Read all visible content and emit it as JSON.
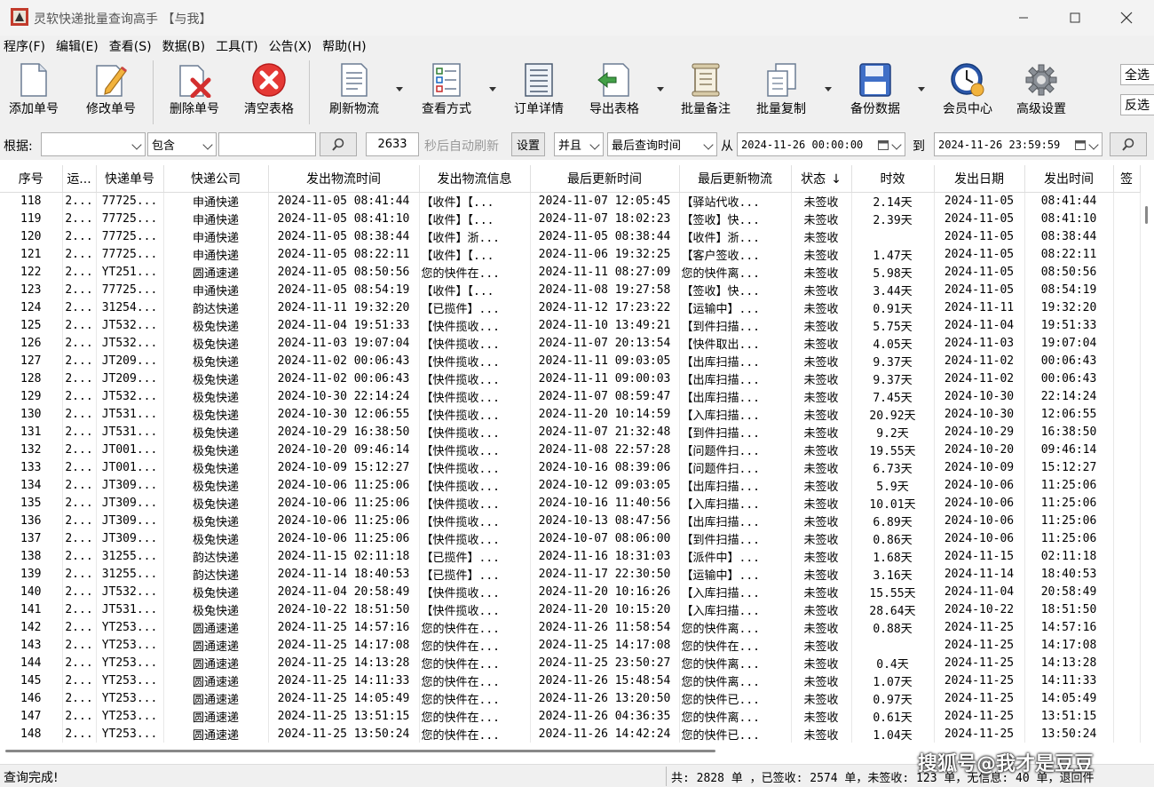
{
  "window": {
    "title": "灵软快递批量查询高手 【与我】"
  },
  "menu": [
    "程序(F)",
    "编辑(E)",
    "查看(S)",
    "数据(B)",
    "工具(T)",
    "公告(X)",
    "帮助(H)"
  ],
  "toolbar": {
    "add": "添加单号",
    "edit": "修改单号",
    "delete": "删除单号",
    "clear": "清空表格",
    "refresh": "刷新物流",
    "view_mode": "查看方式",
    "order_detail": "订单详情",
    "export": "导出表格",
    "batch_note": "批量备注",
    "batch_copy": "批量复制",
    "backup": "备份数据",
    "member": "会员中心",
    "advanced": "高级设置",
    "select_all": "全选",
    "invert": "反选"
  },
  "filter": {
    "basis_label": "根据:",
    "basis_value": "",
    "match": "包含",
    "keyword": "",
    "interval": "2633",
    "auto_refresh": "秒后自动刷新",
    "settings": "设置",
    "logic": "并且",
    "time_field": "最后查询时间",
    "from_label": "从",
    "from": "2024-11-26 00:00:00",
    "to_label": "到",
    "to": "2024-11-26 23:59:59"
  },
  "table": {
    "columns": [
      "序号",
      "运...",
      "快递单号",
      "快递公司",
      "发出物流时间",
      "发出物流信息",
      "最后更新时间",
      "最后更新物流",
      "状态",
      "时效",
      "发出日期",
      "发出时间",
      "签"
    ],
    "sort_col_arrow": "↓",
    "rows": [
      [
        "118",
        "2...",
        "77725...",
        "申通快递",
        "2024-11-05 08:41:44",
        "【收件】【...",
        "2024-11-07 12:05:45",
        "【驿站代收...",
        "未签收",
        "2.14天",
        "2024-11-05",
        "08:41:44"
      ],
      [
        "119",
        "2...",
        "77725...",
        "申通快递",
        "2024-11-05 08:41:10",
        "【收件】【...",
        "2024-11-07 18:02:23",
        "【签收】快...",
        "未签收",
        "2.39天",
        "2024-11-05",
        "08:41:10"
      ],
      [
        "120",
        "2...",
        "77725...",
        "申通快递",
        "2024-11-05 08:38:44",
        "【收件】浙...",
        "2024-11-05 08:38:44",
        "【收件】浙...",
        "未签收",
        "",
        "2024-11-05",
        "08:38:44"
      ],
      [
        "121",
        "2...",
        "77725...",
        "申通快递",
        "2024-11-05 08:22:11",
        "【收件】【...",
        "2024-11-06 19:32:25",
        "【客户签收...",
        "未签收",
        "1.47天",
        "2024-11-05",
        "08:22:11"
      ],
      [
        "122",
        "2...",
        "YT251...",
        "圆通速递",
        "2024-11-05 08:50:56",
        "您的快件在...",
        "2024-11-11 08:27:09",
        "您的快件离...",
        "未签收",
        "5.98天",
        "2024-11-05",
        "08:50:56"
      ],
      [
        "123",
        "2...",
        "77725...",
        "申通快递",
        "2024-11-05 08:54:19",
        "【收件】【...",
        "2024-11-08 19:27:58",
        "【签收】快...",
        "未签收",
        "3.44天",
        "2024-11-05",
        "08:54:19"
      ],
      [
        "124",
        "2...",
        "31254...",
        "韵达快递",
        "2024-11-11 19:32:20",
        "【已揽件】...",
        "2024-11-12 17:23:22",
        "【运输中】...",
        "未签收",
        "0.91天",
        "2024-11-11",
        "19:32:20"
      ],
      [
        "125",
        "2...",
        "JT532...",
        "极兔快递",
        "2024-11-04 19:51:33",
        "【快件揽收...",
        "2024-11-10 13:49:21",
        "【到件扫描...",
        "未签收",
        "5.75天",
        "2024-11-04",
        "19:51:33"
      ],
      [
        "126",
        "2...",
        "JT532...",
        "极兔快递",
        "2024-11-03 19:07:04",
        "【快件揽收...",
        "2024-11-07 20:13:54",
        "【快件取出...",
        "未签收",
        "4.05天",
        "2024-11-03",
        "19:07:04"
      ],
      [
        "127",
        "2...",
        "JT209...",
        "极兔快递",
        "2024-11-02 00:06:43",
        "【快件揽收...",
        "2024-11-11 09:03:05",
        "【出库扫描...",
        "未签收",
        "9.37天",
        "2024-11-02",
        "00:06:43"
      ],
      [
        "128",
        "2...",
        "JT209...",
        "极兔快递",
        "2024-11-02 00:06:43",
        "【快件揽收...",
        "2024-11-11 09:00:03",
        "【出库扫描...",
        "未签收",
        "9.37天",
        "2024-11-02",
        "00:06:43"
      ],
      [
        "129",
        "2...",
        "JT532...",
        "极兔快递",
        "2024-10-30 22:14:24",
        "【快件揽收...",
        "2024-11-07 08:59:47",
        "【出库扫描...",
        "未签收",
        "7.45天",
        "2024-10-30",
        "22:14:24"
      ],
      [
        "130",
        "2...",
        "JT531...",
        "极兔快递",
        "2024-10-30 12:06:55",
        "【快件揽收...",
        "2024-11-20 10:14:59",
        "【入库扫描...",
        "未签收",
        "20.92天",
        "2024-10-30",
        "12:06:55"
      ],
      [
        "131",
        "2...",
        "JT531...",
        "极兔快递",
        "2024-10-29 16:38:50",
        "【快件揽收...",
        "2024-11-07 21:32:48",
        "【到件扫描...",
        "未签收",
        "9.2天",
        "2024-10-29",
        "16:38:50"
      ],
      [
        "132",
        "2...",
        "JT001...",
        "极兔快递",
        "2024-10-20 09:46:14",
        "【快件揽收...",
        "2024-11-08 22:57:28",
        "【问题件扫...",
        "未签收",
        "19.55天",
        "2024-10-20",
        "09:46:14"
      ],
      [
        "133",
        "2...",
        "JT001...",
        "极兔快递",
        "2024-10-09 15:12:27",
        "【快件揽收...",
        "2024-10-16 08:39:06",
        "【问题件扫...",
        "未签收",
        "6.73天",
        "2024-10-09",
        "15:12:27"
      ],
      [
        "134",
        "2...",
        "JT309...",
        "极兔快递",
        "2024-10-06 11:25:06",
        "【快件揽收...",
        "2024-10-12 09:03:05",
        "【出库扫描...",
        "未签收",
        "5.9天",
        "2024-10-06",
        "11:25:06"
      ],
      [
        "135",
        "2...",
        "JT309...",
        "极兔快递",
        "2024-10-06 11:25:06",
        "【快件揽收...",
        "2024-10-16 11:40:56",
        "【入库扫描...",
        "未签收",
        "10.01天",
        "2024-10-06",
        "11:25:06"
      ],
      [
        "136",
        "2...",
        "JT309...",
        "极兔快递",
        "2024-10-06 11:25:06",
        "【快件揽收...",
        "2024-10-13 08:47:56",
        "【出库扫描...",
        "未签收",
        "6.89天",
        "2024-10-06",
        "11:25:06"
      ],
      [
        "137",
        "2...",
        "JT309...",
        "极兔快递",
        "2024-10-06 11:25:06",
        "【快件揽收...",
        "2024-10-07 08:06:00",
        "【到件扫描...",
        "未签收",
        "0.86天",
        "2024-10-06",
        "11:25:06"
      ],
      [
        "138",
        "2...",
        "31255...",
        "韵达快递",
        "2024-11-15 02:11:18",
        "【已揽件】...",
        "2024-11-16 18:31:03",
        "【派件中】...",
        "未签收",
        "1.68天",
        "2024-11-15",
        "02:11:18"
      ],
      [
        "139",
        "2...",
        "31255...",
        "韵达快递",
        "2024-11-14 18:40:53",
        "【已揽件】...",
        "2024-11-17 22:30:50",
        "【运输中】...",
        "未签收",
        "3.16天",
        "2024-11-14",
        "18:40:53"
      ],
      [
        "140",
        "2...",
        "JT532...",
        "极兔快递",
        "2024-11-04 20:58:49",
        "【快件揽收...",
        "2024-11-20 10:16:26",
        "【入库扫描...",
        "未签收",
        "15.55天",
        "2024-11-04",
        "20:58:49"
      ],
      [
        "141",
        "2...",
        "JT531...",
        "极兔快递",
        "2024-10-22 18:51:50",
        "【快件揽收...",
        "2024-11-20 10:15:20",
        "【入库扫描...",
        "未签收",
        "28.64天",
        "2024-10-22",
        "18:51:50"
      ],
      [
        "142",
        "2...",
        "YT253...",
        "圆通速递",
        "2024-11-25 14:57:16",
        "您的快件在...",
        "2024-11-26 11:58:54",
        "您的快件离...",
        "未签收",
        "0.88天",
        "2024-11-25",
        "14:57:16"
      ],
      [
        "143",
        "2...",
        "YT253...",
        "圆通速递",
        "2024-11-25 14:17:08",
        "您的快件在...",
        "2024-11-25 14:17:08",
        "您的快件在...",
        "未签收",
        "",
        "2024-11-25",
        "14:17:08"
      ],
      [
        "144",
        "2...",
        "YT253...",
        "圆通速递",
        "2024-11-25 14:13:28",
        "您的快件在...",
        "2024-11-25 23:50:27",
        "您的快件离...",
        "未签收",
        "0.4天",
        "2024-11-25",
        "14:13:28"
      ],
      [
        "145",
        "2...",
        "YT253...",
        "圆通速递",
        "2024-11-25 14:11:33",
        "您的快件在...",
        "2024-11-26 15:48:54",
        "您的快件离...",
        "未签收",
        "1.07天",
        "2024-11-25",
        "14:11:33"
      ],
      [
        "146",
        "2...",
        "YT253...",
        "圆通速递",
        "2024-11-25 14:05:49",
        "您的快件在...",
        "2024-11-26 13:20:50",
        "您的快件已...",
        "未签收",
        "0.97天",
        "2024-11-25",
        "14:05:49"
      ],
      [
        "147",
        "2...",
        "YT253...",
        "圆通速递",
        "2024-11-25 13:51:15",
        "您的快件在...",
        "2024-11-26 04:36:35",
        "您的快件离...",
        "未签收",
        "0.61天",
        "2024-11-25",
        "13:51:15"
      ],
      [
        "148",
        "2...",
        "YT253...",
        "圆通速递",
        "2024-11-25 13:50:24",
        "您的快件在...",
        "2024-11-26 14:42:24",
        "您的快件已...",
        "未签收",
        "1.04天",
        "2024-11-25",
        "13:50:24"
      ]
    ]
  },
  "status": {
    "left": "查询完成!",
    "right": "共: 2828 单 ，已签收:  2574 单，未签收: 123 单，无信息: 40 单，退回件"
  },
  "watermark": "搜狐号@我才是豆豆"
}
